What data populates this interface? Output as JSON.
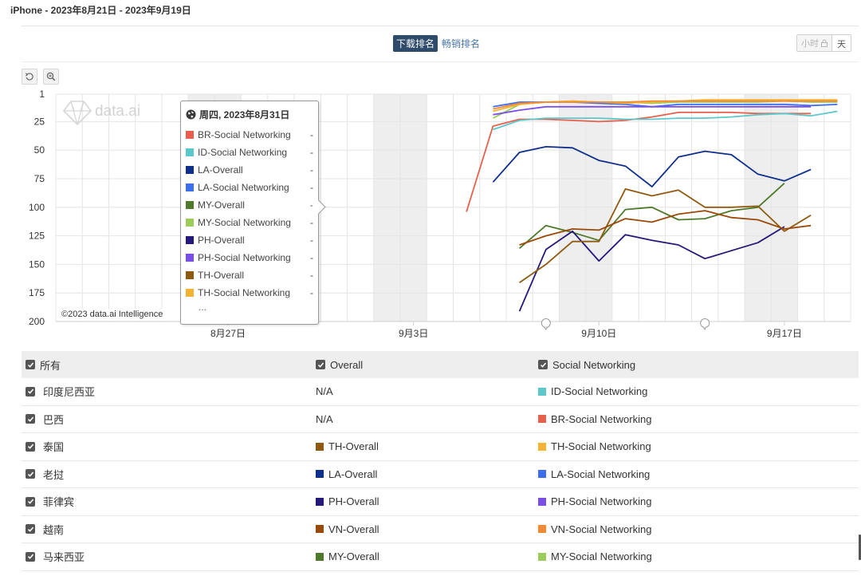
{
  "page": {
    "title": "iPhone - 2023年8月21日 - 2023年9月19日"
  },
  "tabs": {
    "downloads": "下载排名",
    "revenue": "畅销排名"
  },
  "granularity": {
    "hour": "小时",
    "day": "天"
  },
  "tools": [
    {
      "icon": "reset-zoom-icon"
    },
    {
      "icon": "zoom-icon"
    }
  ],
  "watermark": "data.ai",
  "copyright": "©2023 data.ai Intelligence",
  "tooltip": {
    "date": "周四, 2023年8月31日",
    "more": "...",
    "rows": [
      {
        "name": "BR-Social Networking",
        "value": "-",
        "color": "#e8604c"
      },
      {
        "name": "ID-Social Networking",
        "value": "-",
        "color": "#5cc8cc"
      },
      {
        "name": "LA-Overall",
        "value": "-",
        "color": "#0f2f8c"
      },
      {
        "name": "LA-Social Networking",
        "value": "-",
        "color": "#3d6ef0"
      },
      {
        "name": "MY-Overall",
        "value": "-",
        "color": "#4e7a2a"
      },
      {
        "name": "MY-Social Networking",
        "value": "-",
        "color": "#9ccc5a"
      },
      {
        "name": "PH-Overall",
        "value": "-",
        "color": "#24197a"
      },
      {
        "name": "PH-Social Networking",
        "value": "-",
        "color": "#7a4ee8"
      },
      {
        "name": "TH-Overall",
        "value": "-",
        "color": "#8f5a10"
      },
      {
        "name": "TH-Social Networking",
        "value": "-",
        "color": "#f5b335"
      }
    ]
  },
  "chart_data": {
    "type": "line",
    "y_reversed": true,
    "ylim": [
      1,
      200
    ],
    "yticks": [
      "1",
      "25",
      "50",
      "75",
      "100",
      "125",
      "150",
      "175",
      "200"
    ],
    "ytick_values": [
      1,
      25,
      50,
      75,
      100,
      125,
      150,
      175,
      200
    ],
    "x_start": "2023-08-21",
    "x_end": "2023-09-19",
    "xticks": [
      {
        "label": "8月27日",
        "date": "2023-08-27"
      },
      {
        "label": "9月3日",
        "date": "2023-09-03"
      },
      {
        "label": "9月10日",
        "date": "2023-09-10"
      },
      {
        "label": "9月17日",
        "date": "2023-09-17"
      }
    ],
    "weekend_bands": [
      [
        "2023-08-26",
        "2023-08-27"
      ],
      [
        "2023-09-02",
        "2023-09-03"
      ],
      [
        "2023-09-09",
        "2023-09-10"
      ],
      [
        "2023-09-16",
        "2023-09-17"
      ]
    ],
    "hover_date": "2023-08-31",
    "event_markers": [
      "2023-09-08",
      "2023-09-14"
    ],
    "series": [
      {
        "name": "BR-Social Networking",
        "color": "#e8604c",
        "points": [
          [
            "2023-09-05",
            104
          ],
          [
            "2023-09-06",
            29
          ],
          [
            "2023-09-07",
            23
          ],
          [
            "2023-09-08",
            23
          ],
          [
            "2023-09-09",
            24
          ],
          [
            "2023-09-10",
            25
          ],
          [
            "2023-09-11",
            24
          ],
          [
            "2023-09-12",
            21
          ],
          [
            "2023-09-13",
            17
          ],
          [
            "2023-09-14",
            17
          ],
          [
            "2023-09-15",
            17
          ],
          [
            "2023-09-16",
            18
          ],
          [
            "2023-09-17",
            18
          ],
          [
            "2023-09-18",
            18
          ]
        ]
      },
      {
        "name": "ID-Social Networking",
        "color": "#5cc8cc",
        "points": [
          [
            "2023-09-06",
            32
          ],
          [
            "2023-09-07",
            24
          ],
          [
            "2023-09-08",
            22
          ],
          [
            "2023-09-09",
            22
          ],
          [
            "2023-09-10",
            22
          ],
          [
            "2023-09-11",
            23
          ],
          [
            "2023-09-12",
            23
          ],
          [
            "2023-09-13",
            22
          ],
          [
            "2023-09-14",
            22
          ],
          [
            "2023-09-15",
            21
          ],
          [
            "2023-09-16",
            19
          ],
          [
            "2023-09-17",
            18
          ],
          [
            "2023-09-18",
            20
          ],
          [
            "2023-09-19",
            16
          ]
        ]
      },
      {
        "name": "LA-Overall",
        "color": "#0f2f8c",
        "points": [
          [
            "2023-09-06",
            78
          ],
          [
            "2023-09-07",
            52
          ],
          [
            "2023-09-08",
            47
          ],
          [
            "2023-09-09",
            48
          ],
          [
            "2023-09-10",
            59
          ],
          [
            "2023-09-11",
            64
          ],
          [
            "2023-09-12",
            82
          ],
          [
            "2023-09-13",
            56
          ],
          [
            "2023-09-14",
            51
          ],
          [
            "2023-09-15",
            54
          ],
          [
            "2023-09-16",
            71
          ],
          [
            "2023-09-17",
            77
          ],
          [
            "2023-09-18",
            67
          ]
        ]
      },
      {
        "name": "LA-Social Networking",
        "color": "#3d6ef0",
        "points": [
          [
            "2023-09-06",
            12
          ],
          [
            "2023-09-07",
            8
          ],
          [
            "2023-09-08",
            8
          ],
          [
            "2023-09-09",
            8
          ],
          [
            "2023-09-10",
            9
          ],
          [
            "2023-09-11",
            10
          ],
          [
            "2023-09-12",
            12
          ],
          [
            "2023-09-13",
            10
          ],
          [
            "2023-09-14",
            10
          ],
          [
            "2023-09-15",
            10
          ],
          [
            "2023-09-16",
            10
          ],
          [
            "2023-09-17",
            10
          ],
          [
            "2023-09-18",
            11
          ],
          [
            "2023-09-19",
            10
          ]
        ]
      },
      {
        "name": "MY-Overall",
        "color": "#4e7a2a",
        "points": [
          [
            "2023-09-07",
            136
          ],
          [
            "2023-09-08",
            116
          ],
          [
            "2023-09-09",
            122
          ],
          [
            "2023-09-10",
            129
          ],
          [
            "2023-09-11",
            102
          ],
          [
            "2023-09-12",
            100
          ],
          [
            "2023-09-13",
            111
          ],
          [
            "2023-09-14",
            110
          ],
          [
            "2023-09-15",
            103
          ],
          [
            "2023-09-16",
            100
          ],
          [
            "2023-09-17",
            79
          ]
        ]
      },
      {
        "name": "MY-Social Networking",
        "color": "#9ccc5a",
        "points": [
          [
            "2023-09-06",
            22
          ],
          [
            "2023-09-07",
            10
          ],
          [
            "2023-09-08",
            8
          ],
          [
            "2023-09-09",
            7
          ],
          [
            "2023-09-10",
            8
          ],
          [
            "2023-09-11",
            8
          ],
          [
            "2023-09-12",
            9
          ],
          [
            "2023-09-13",
            8
          ],
          [
            "2023-09-14",
            8
          ],
          [
            "2023-09-15",
            8
          ],
          [
            "2023-09-16",
            8
          ],
          [
            "2023-09-17",
            7
          ],
          [
            "2023-09-18",
            8
          ],
          [
            "2023-09-19",
            8
          ]
        ]
      },
      {
        "name": "PH-Overall",
        "color": "#24197a",
        "points": [
          [
            "2023-09-07",
            191
          ],
          [
            "2023-09-08",
            137
          ],
          [
            "2023-09-09",
            121
          ],
          [
            "2023-09-10",
            147
          ],
          [
            "2023-09-11",
            124
          ],
          [
            "2023-09-12",
            129
          ],
          [
            "2023-09-13",
            133
          ],
          [
            "2023-09-14",
            145
          ],
          [
            "2023-09-15",
            138
          ],
          [
            "2023-09-16",
            131
          ],
          [
            "2023-09-17",
            117
          ]
        ]
      },
      {
        "name": "PH-Social Networking",
        "color": "#7a4ee8",
        "points": [
          [
            "2023-09-06",
            19
          ],
          [
            "2023-09-07",
            15
          ],
          [
            "2023-09-08",
            12
          ],
          [
            "2023-09-09",
            12
          ],
          [
            "2023-09-10",
            12
          ],
          [
            "2023-09-11",
            12
          ],
          [
            "2023-09-12",
            12
          ],
          [
            "2023-09-13",
            12
          ],
          [
            "2023-09-14",
            12
          ],
          [
            "2023-09-15",
            12
          ],
          [
            "2023-09-16",
            12
          ],
          [
            "2023-09-17",
            12
          ],
          [
            "2023-09-18",
            12
          ]
        ]
      },
      {
        "name": "TH-Overall",
        "color": "#8f5a10",
        "points": [
          [
            "2023-09-07",
            166
          ],
          [
            "2023-09-08",
            150
          ],
          [
            "2023-09-09",
            130
          ],
          [
            "2023-09-10",
            130
          ],
          [
            "2023-09-11",
            84
          ],
          [
            "2023-09-12",
            90
          ],
          [
            "2023-09-13",
            85
          ],
          [
            "2023-09-14",
            100
          ],
          [
            "2023-09-15",
            100
          ],
          [
            "2023-09-16",
            99
          ],
          [
            "2023-09-17",
            121
          ],
          [
            "2023-09-18",
            107
          ]
        ]
      },
      {
        "name": "TH-Social Networking",
        "color": "#f5b335",
        "points": [
          [
            "2023-09-06",
            16
          ],
          [
            "2023-09-07",
            10
          ],
          [
            "2023-09-08",
            8
          ],
          [
            "2023-09-09",
            7
          ],
          [
            "2023-09-10",
            8
          ],
          [
            "2023-09-11",
            9
          ],
          [
            "2023-09-12",
            8
          ],
          [
            "2023-09-13",
            7
          ],
          [
            "2023-09-14",
            6
          ],
          [
            "2023-09-15",
            6
          ],
          [
            "2023-09-16",
            6
          ],
          [
            "2023-09-17",
            6
          ],
          [
            "2023-09-18",
            6
          ],
          [
            "2023-09-19",
            6
          ]
        ]
      },
      {
        "name": "VN-Overall",
        "color": "#9a4a08",
        "points": [
          [
            "2023-09-07",
            133
          ],
          [
            "2023-09-08",
            125
          ],
          [
            "2023-09-09",
            119
          ],
          [
            "2023-09-10",
            120
          ],
          [
            "2023-09-11",
            110
          ],
          [
            "2023-09-12",
            113
          ],
          [
            "2023-09-13",
            106
          ],
          [
            "2023-09-14",
            103
          ],
          [
            "2023-09-15",
            109
          ],
          [
            "2023-09-16",
            111
          ],
          [
            "2023-09-17",
            119
          ],
          [
            "2023-09-18",
            116
          ]
        ]
      },
      {
        "name": "VN-Social Networking",
        "color": "#f58a35",
        "points": [
          [
            "2023-09-06",
            14
          ],
          [
            "2023-09-07",
            9
          ],
          [
            "2023-09-08",
            8
          ],
          [
            "2023-09-09",
            8
          ],
          [
            "2023-09-10",
            8
          ],
          [
            "2023-09-11",
            8
          ],
          [
            "2023-09-12",
            7
          ],
          [
            "2023-09-13",
            7
          ],
          [
            "2023-09-14",
            7
          ],
          [
            "2023-09-15",
            7
          ],
          [
            "2023-09-16",
            7
          ],
          [
            "2023-09-17",
            7
          ],
          [
            "2023-09-18",
            7
          ],
          [
            "2023-09-19",
            7
          ]
        ]
      }
    ]
  },
  "legend": {
    "header": {
      "all": "所有",
      "overall": "Overall",
      "social": "Social Networking"
    },
    "rows": [
      {
        "country": "印度尼西亚",
        "overall": {
          "label": "N/A",
          "color": null
        },
        "social": {
          "label": "ID-Social Networking",
          "color": "#5cc8cc"
        }
      },
      {
        "country": "巴西",
        "overall": {
          "label": "N/A",
          "color": null
        },
        "social": {
          "label": "BR-Social Networking",
          "color": "#e8604c"
        }
      },
      {
        "country": "泰国",
        "overall": {
          "label": "TH-Overall",
          "color": "#8f5a10"
        },
        "social": {
          "label": "TH-Social Networking",
          "color": "#f5b335"
        }
      },
      {
        "country": "老挝",
        "overall": {
          "label": "LA-Overall",
          "color": "#0f2f8c"
        },
        "social": {
          "label": "LA-Social Networking",
          "color": "#3d6ef0"
        }
      },
      {
        "country": "菲律宾",
        "overall": {
          "label": "PH-Overall",
          "color": "#24197a"
        },
        "social": {
          "label": "PH-Social Networking",
          "color": "#7a4ee8"
        }
      },
      {
        "country": "越南",
        "overall": {
          "label": "VN-Overall",
          "color": "#9a4a08"
        },
        "social": {
          "label": "VN-Social Networking",
          "color": "#f58a35"
        }
      },
      {
        "country": "马来西亚",
        "overall": {
          "label": "MY-Overall",
          "color": "#4e7a2a"
        },
        "social": {
          "label": "MY-Social Networking",
          "color": "#9ccc5a"
        }
      }
    ]
  }
}
